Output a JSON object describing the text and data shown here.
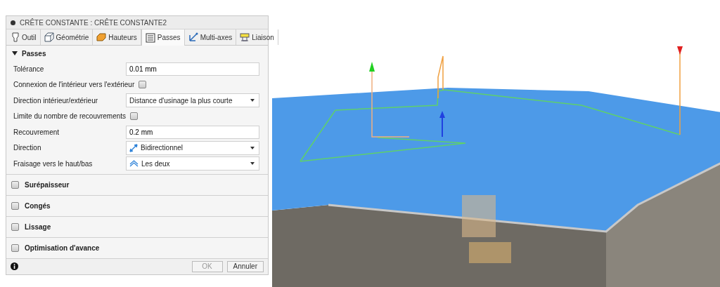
{
  "dialog": {
    "title": "CRÊTE CONSTANTE : CRÊTE CONSTANTE2",
    "tabs": [
      {
        "label": "Outil",
        "selected": false
      },
      {
        "label": "Géométrie",
        "selected": false
      },
      {
        "label": "Hauteurs",
        "selected": false
      },
      {
        "label": "Passes",
        "selected": true
      },
      {
        "label": "Multi-axes",
        "selected": false
      },
      {
        "label": "Liaison",
        "selected": false
      }
    ],
    "section": {
      "title": "Passes",
      "expanded": true,
      "fields": [
        {
          "kind": "text",
          "label": "Tolérance",
          "value": "0.01 mm"
        },
        {
          "kind": "checkbox",
          "label": "Connexion de l'intérieur vers l'extérieur",
          "checked": false
        },
        {
          "kind": "select",
          "label": "Direction intérieur/extérieur",
          "value": "Distance d'usinage la plus courte"
        },
        {
          "kind": "checkbox",
          "label": "Limite du nombre de recouvrements",
          "checked": false
        },
        {
          "kind": "text",
          "label": "Recouvrement",
          "value": "0.2 mm"
        },
        {
          "kind": "direction-select",
          "label": "Direction",
          "value": "Bidirectionnel"
        },
        {
          "kind": "milling-select",
          "label": "Fraisage vers le haut/bas",
          "value": "Les deux"
        }
      ]
    },
    "groups": [
      {
        "label": "Surépaisseur",
        "checked": false
      },
      {
        "label": "Congés",
        "checked": false
      },
      {
        "label": "Lissage",
        "checked": false
      },
      {
        "label": "Optimisation d'avance",
        "checked": false
      }
    ],
    "buttons": [
      {
        "label": "OK",
        "disabled": true
      },
      {
        "label": "Annuler",
        "disabled": false
      }
    ]
  }
}
